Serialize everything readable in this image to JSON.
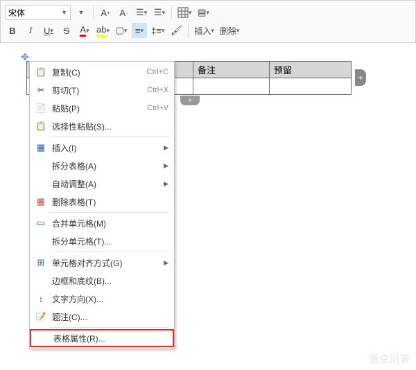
{
  "toolbar": {
    "font_name": "宋体",
    "insert_label": "插入",
    "delete_label": "删除"
  },
  "table": {
    "headers": [
      "",
      "备注",
      "预留"
    ]
  },
  "menu": {
    "copy": "复制(C)",
    "copy_sc": "Ctrl+C",
    "cut": "剪切(T)",
    "cut_sc": "Ctrl+X",
    "paste": "粘贴(P)",
    "paste_sc": "Ctrl+V",
    "paste_special": "选择性粘贴(S)...",
    "insert": "插入(I)",
    "split_table": "拆分表格(A)",
    "autofit": "自动调整(A)",
    "delete_table": "删除表格(T)",
    "merge_cells": "合并单元格(M)",
    "split_cells": "拆分单元格(T)...",
    "cell_align": "单元格对齐方式(G)",
    "borders_shading": "边框和底纹(B)...",
    "text_direction": "文字方向(X)...",
    "caption": "题注(C)...",
    "table_props": "表格属性(R)..."
  },
  "watermark": "悟空问答"
}
